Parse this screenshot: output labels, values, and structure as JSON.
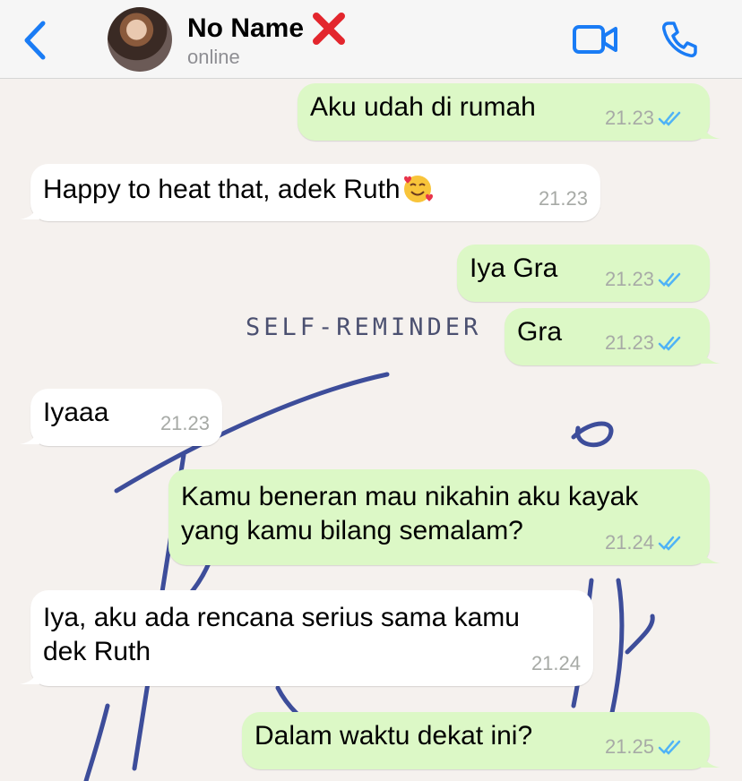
{
  "header": {
    "contact_name": "No Name",
    "status": "online",
    "accent_color": "#1a7cf5",
    "icons": [
      "back-chevron-icon",
      "avatar",
      "red-x-icon",
      "video-camera-icon",
      "phone-icon"
    ]
  },
  "wallpaper": {
    "text": "SELF-REMINDER"
  },
  "messages": [
    {
      "direction": "out",
      "text": "Aku udah di rumah",
      "time": "21.23",
      "status": "read"
    },
    {
      "direction": "in",
      "text": "Happy to heat that, adek Ruth",
      "emoji": "smiling-face-with-hearts",
      "time": "21.23"
    },
    {
      "direction": "out",
      "text": "Iya Gra",
      "time": "21.23",
      "status": "read"
    },
    {
      "direction": "out",
      "text": "Gra",
      "time": "21.23",
      "status": "read"
    },
    {
      "direction": "in",
      "text": "Iyaaa",
      "time": "21.23"
    },
    {
      "direction": "out",
      "text": "Kamu beneran mau nikahin aku kayak\nyang kamu bilang semalam?",
      "time": "21.24",
      "status": "read"
    },
    {
      "direction": "in",
      "text": "Iya, aku ada rencana serius sama kamu\ndek Ruth",
      "time": "21.24"
    },
    {
      "direction": "out",
      "text": "Dalam waktu dekat ini?",
      "time": "21.25",
      "status": "read"
    }
  ],
  "colors": {
    "incoming_bubble": "#ffffff",
    "outgoing_bubble": "#dcf8c6",
    "read_ticks": "#4fb3f6"
  }
}
